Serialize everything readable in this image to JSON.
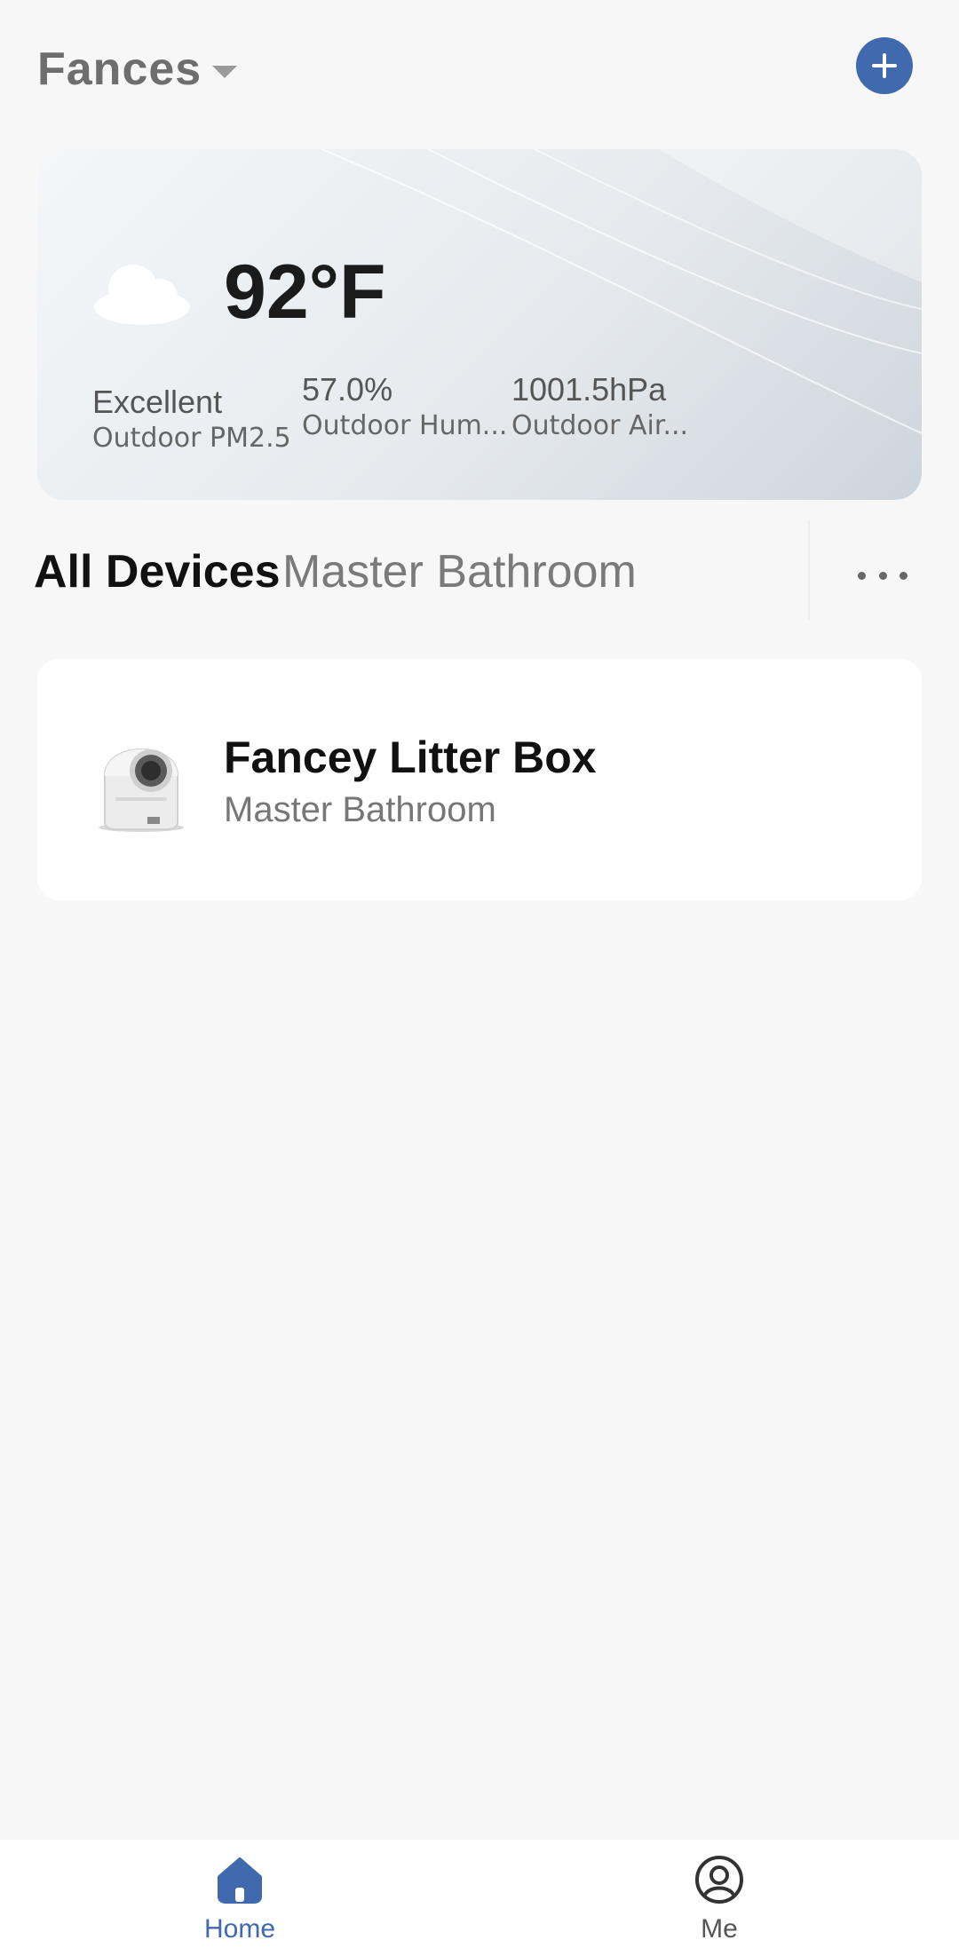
{
  "header": {
    "home_name": "Fances"
  },
  "weather": {
    "temperature": "92°F",
    "pm25_value": "Excellent",
    "pm25_label": "Outdoor PM2.5",
    "humidity_value": "57.0%",
    "humidity_label": "Outdoor Hum...",
    "air_value": "1001.5hPa",
    "air_label": "Outdoor Air..."
  },
  "tabs": [
    {
      "label": "All Devices",
      "active": true
    },
    {
      "label": "Master Bathroom",
      "active": false
    }
  ],
  "devices": [
    {
      "name": "Fancey Litter Box",
      "room": "Master Bathroom"
    }
  ],
  "bottom_nav": [
    {
      "label": "Home",
      "icon": "home-icon",
      "active": true
    },
    {
      "label": "Me",
      "icon": "profile-icon",
      "active": false
    }
  ],
  "colors": {
    "accent": "#4169ad",
    "background": "#f7f7f7"
  }
}
